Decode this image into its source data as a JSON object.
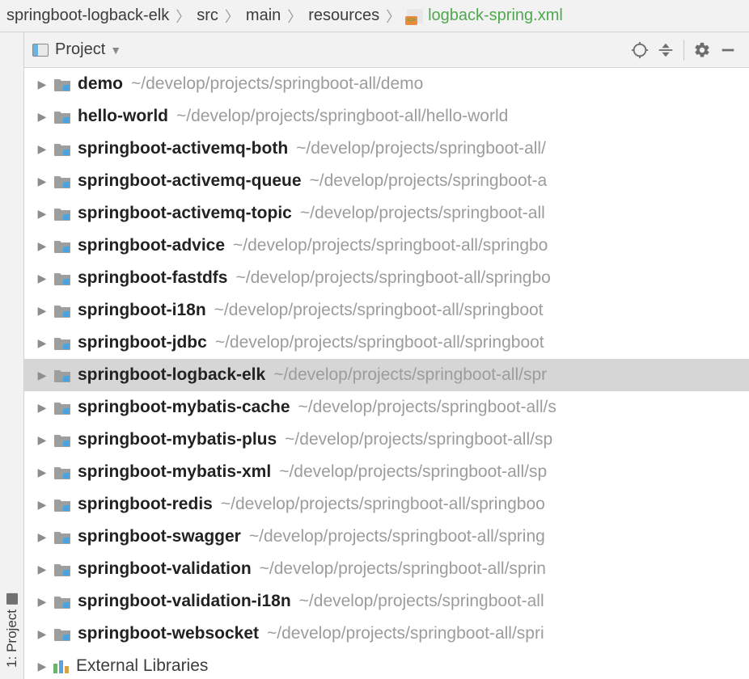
{
  "breadcrumbs": [
    {
      "label": "springboot-logback-elk",
      "kind": "module"
    },
    {
      "label": "src",
      "kind": "folder"
    },
    {
      "label": "main",
      "kind": "folder"
    },
    {
      "label": "resources",
      "kind": "folder"
    },
    {
      "label": "logback-spring.xml",
      "kind": "xml-file"
    }
  ],
  "panel": {
    "title": "Project"
  },
  "left_gutter": {
    "tab_label": "1: Project"
  },
  "tree": {
    "path_prefix": "~/develop/projects/springboot-all/",
    "selected_index": 9,
    "items": [
      {
        "name": "demo",
        "path": "~/develop/projects/springboot-all/demo"
      },
      {
        "name": "hello-world",
        "path": "~/develop/projects/springboot-all/hello-world"
      },
      {
        "name": "springboot-activemq-both",
        "path": "~/develop/projects/springboot-all/"
      },
      {
        "name": "springboot-activemq-queue",
        "path": "~/develop/projects/springboot-a"
      },
      {
        "name": "springboot-activemq-topic",
        "path": "~/develop/projects/springboot-all"
      },
      {
        "name": "springboot-advice",
        "path": "~/develop/projects/springboot-all/springbo"
      },
      {
        "name": "springboot-fastdfs",
        "path": "~/develop/projects/springboot-all/springbo"
      },
      {
        "name": "springboot-i18n",
        "path": "~/develop/projects/springboot-all/springboot"
      },
      {
        "name": "springboot-jdbc",
        "path": "~/develop/projects/springboot-all/springboot"
      },
      {
        "name": "springboot-logback-elk",
        "path": "~/develop/projects/springboot-all/spr"
      },
      {
        "name": "springboot-mybatis-cache",
        "path": "~/develop/projects/springboot-all/s"
      },
      {
        "name": "springboot-mybatis-plus",
        "path": "~/develop/projects/springboot-all/sp"
      },
      {
        "name": "springboot-mybatis-xml",
        "path": "~/develop/projects/springboot-all/sp"
      },
      {
        "name": "springboot-redis",
        "path": "~/develop/projects/springboot-all/springboo"
      },
      {
        "name": "springboot-swagger",
        "path": "~/develop/projects/springboot-all/spring"
      },
      {
        "name": "springboot-validation",
        "path": "~/develop/projects/springboot-all/sprin"
      },
      {
        "name": "springboot-validation-i18n",
        "path": "~/develop/projects/springboot-all"
      },
      {
        "name": "springboot-websocket",
        "path": "~/develop/projects/springboot-all/spri"
      }
    ],
    "external_libraries_label": "External Libraries"
  }
}
